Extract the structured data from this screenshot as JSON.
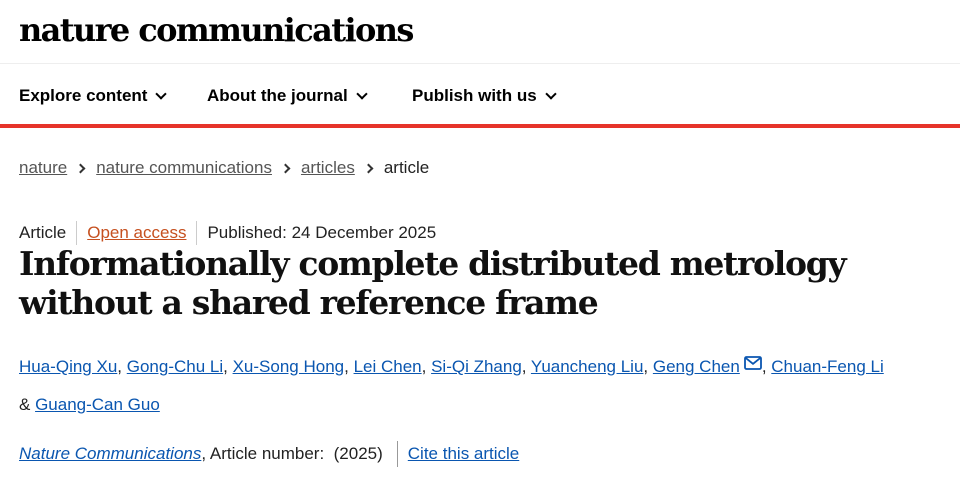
{
  "header": {
    "logo": "nature communications"
  },
  "nav": {
    "items": [
      {
        "label": "Explore content",
        "icon": "chevron-down-icon"
      },
      {
        "label": "About the journal",
        "icon": "chevron-down-icon"
      },
      {
        "label": "Publish with us",
        "icon": "chevron-down-icon"
      }
    ],
    "accent_color": "#e6332a"
  },
  "breadcrumb": {
    "items": [
      "nature",
      "nature communications",
      "articles"
    ],
    "current": "article"
  },
  "article": {
    "type": "Article",
    "access": "Open access",
    "published": "Published: 24 December 2025",
    "title": "Informationally complete distributed metrology without a shared reference frame",
    "authors": [
      "Hua-Qing Xu",
      "Gong-Chu Li",
      "Xu-Song Hong",
      "Lei Chen",
      "Si-Qi Zhang",
      "Yuancheng Liu",
      "Geng Chen",
      "Chuan-Feng Li",
      "Guang-Can Guo"
    ],
    "corresponding_icon": "mail-icon"
  },
  "citation": {
    "journal": "Nature Communications",
    "article_number": ", Article number:  (2025)",
    "cite_label": "Cite this article"
  },
  "colors": {
    "link": "#0a56b0",
    "open_access": "#c6501f"
  }
}
